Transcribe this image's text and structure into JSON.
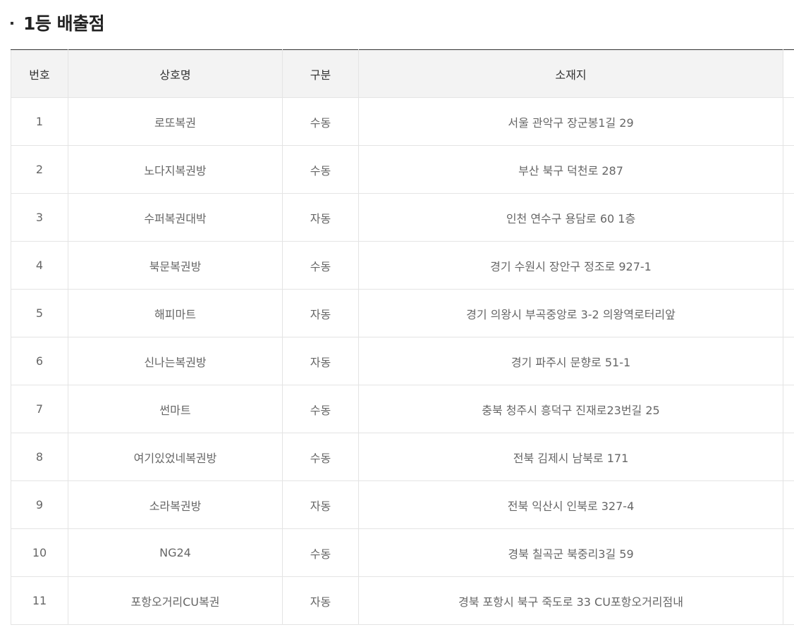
{
  "section": {
    "title": "1등 배출점"
  },
  "table": {
    "headers": {
      "no": "번호",
      "name": "상호명",
      "type": "구분",
      "address": "소재지"
    },
    "rows": [
      {
        "no": "1",
        "name": "로또복권",
        "type": "수동",
        "address": "서울 관악구 장군봉1길 29"
      },
      {
        "no": "2",
        "name": "노다지복권방",
        "type": "수동",
        "address": "부산 북구 덕천로 287"
      },
      {
        "no": "3",
        "name": "수퍼복권대박",
        "type": "자동",
        "address": "인천 연수구 용담로 60 1층"
      },
      {
        "no": "4",
        "name": "북문복권방",
        "type": "수동",
        "address": "경기 수원시 장안구 정조로 927-1"
      },
      {
        "no": "5",
        "name": "해피마트",
        "type": "자동",
        "address": "경기 의왕시 부곡중앙로 3-2 의왕역로터리앞"
      },
      {
        "no": "6",
        "name": "신나는복권방",
        "type": "자동",
        "address": "경기 파주시 문향로 51-1"
      },
      {
        "no": "7",
        "name": "썬마트",
        "type": "수동",
        "address": "충북 청주시 흥덕구 진재로23번길 25"
      },
      {
        "no": "8",
        "name": "여기있었네복권방",
        "type": "수동",
        "address": "전북 김제시 남북로 171"
      },
      {
        "no": "9",
        "name": "소라복권방",
        "type": "자동",
        "address": "전북 익산시 인북로 327-4"
      },
      {
        "no": "10",
        "name": "NG24",
        "type": "수동",
        "address": "경북 칠곡군 북중리3길 59"
      },
      {
        "no": "11",
        "name": "포항오거리CU복권",
        "type": "자동",
        "address": "경북 포항시 북구 죽도로 33 CU포항오거리점내"
      }
    ]
  },
  "colors": {
    "header_bg": "#f3f3f3",
    "border": "#e4e4e4",
    "top_border": "#333333",
    "text": "#666666"
  }
}
